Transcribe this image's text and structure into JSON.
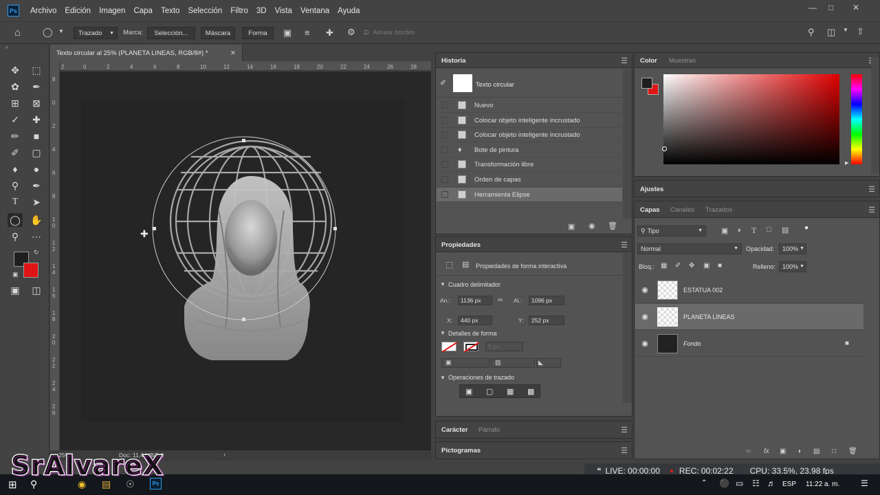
{
  "app": {
    "logo": "Ps",
    "menu": [
      "Archivo",
      "Edición",
      "Imagen",
      "Capa",
      "Texto",
      "Selección",
      "Filtro",
      "3D",
      "Vista",
      "Ventana",
      "Ayuda"
    ]
  },
  "options_bar": {
    "mode_value": "Trazado",
    "marca_label": "Marca:",
    "seleccion_button": "Selección...",
    "mascara_button": "Máscara",
    "forma_button": "Forma",
    "alinear_bordes": "Alinear bordes"
  },
  "document": {
    "tab_title": "Texto circular al 25% (PLANETA LINEAS, RGB/8#) *",
    "ruler_top": [
      "2",
      "0",
      "2",
      "4",
      "6",
      "8",
      "10",
      "12",
      "14",
      "16",
      "18",
      "20",
      "22",
      "24",
      "26",
      "28"
    ],
    "ruler_left": [
      "8",
      "0",
      "2",
      "4",
      "6",
      "8",
      "1 0",
      "1 2",
      "1 4",
      "1 6",
      "1 8",
      "2 0",
      "2 2",
      "2 4",
      "2 6"
    ],
    "zoom": "25%",
    "doc_info": "Doc: 11,4 MB/5,1"
  },
  "history": {
    "tab": "Historia",
    "snapshot_label": "Texto circular",
    "items": [
      {
        "label": "Nuevo"
      },
      {
        "label": "Colocar objeto inteligente incrustado"
      },
      {
        "label": "Colocar objeto inteligente incrustado"
      },
      {
        "label": "Bote de pintura"
      },
      {
        "label": "Transformación libre"
      },
      {
        "label": "Orden de capas"
      },
      {
        "label": "Herramienta Elipse"
      }
    ]
  },
  "properties": {
    "tab": "Propiedades",
    "subtitle": "Propiedades de forma interactiva",
    "section_bbox": "Cuadro delimitador",
    "an_label": "An.:",
    "an_value": "1136 px",
    "al_label": "Al.:",
    "al_value": "1096 px",
    "x_label": "X:",
    "x_value": "440 px",
    "y_label": "Y:",
    "y_value": "252 px",
    "section_shape": "Detalles de forma",
    "stroke_value": "0 px",
    "section_ops": "Operaciones de trazado"
  },
  "caracter": {
    "tab1": "Carácter",
    "tab2": "Párrafo"
  },
  "pictogramas": {
    "tab": "Pictogramas"
  },
  "color_panel": {
    "tab1": "Color",
    "tab2": "Muestras",
    "fg_color": "#1f1f1f",
    "bg_color": "#e01515"
  },
  "ajustes": {
    "tab": "Ajustes"
  },
  "layers": {
    "tabs": [
      "Capas",
      "Canales",
      "Trazados"
    ],
    "filter_value": "Tipo",
    "blend_mode": "Normal",
    "opacity_label": "Opacidad:",
    "opacity_value": "100%",
    "lock_label": "Bloq.:",
    "fill_label": "Relleno:",
    "fill_value": "100%",
    "items": [
      {
        "name": "ESTATUA 002"
      },
      {
        "name": "PLANETA LINEAS"
      },
      {
        "name": "Fondo"
      }
    ]
  },
  "recording": {
    "live": "LIVE: 00:00:00",
    "rec": "REC: 00:02:22",
    "cpu": "CPU: 33.5%, 23.98 fps"
  },
  "taskbar": {
    "lang": "ESP",
    "time": "11:22 a. m."
  },
  "watermark": {
    "text": "SrAlvareX"
  }
}
